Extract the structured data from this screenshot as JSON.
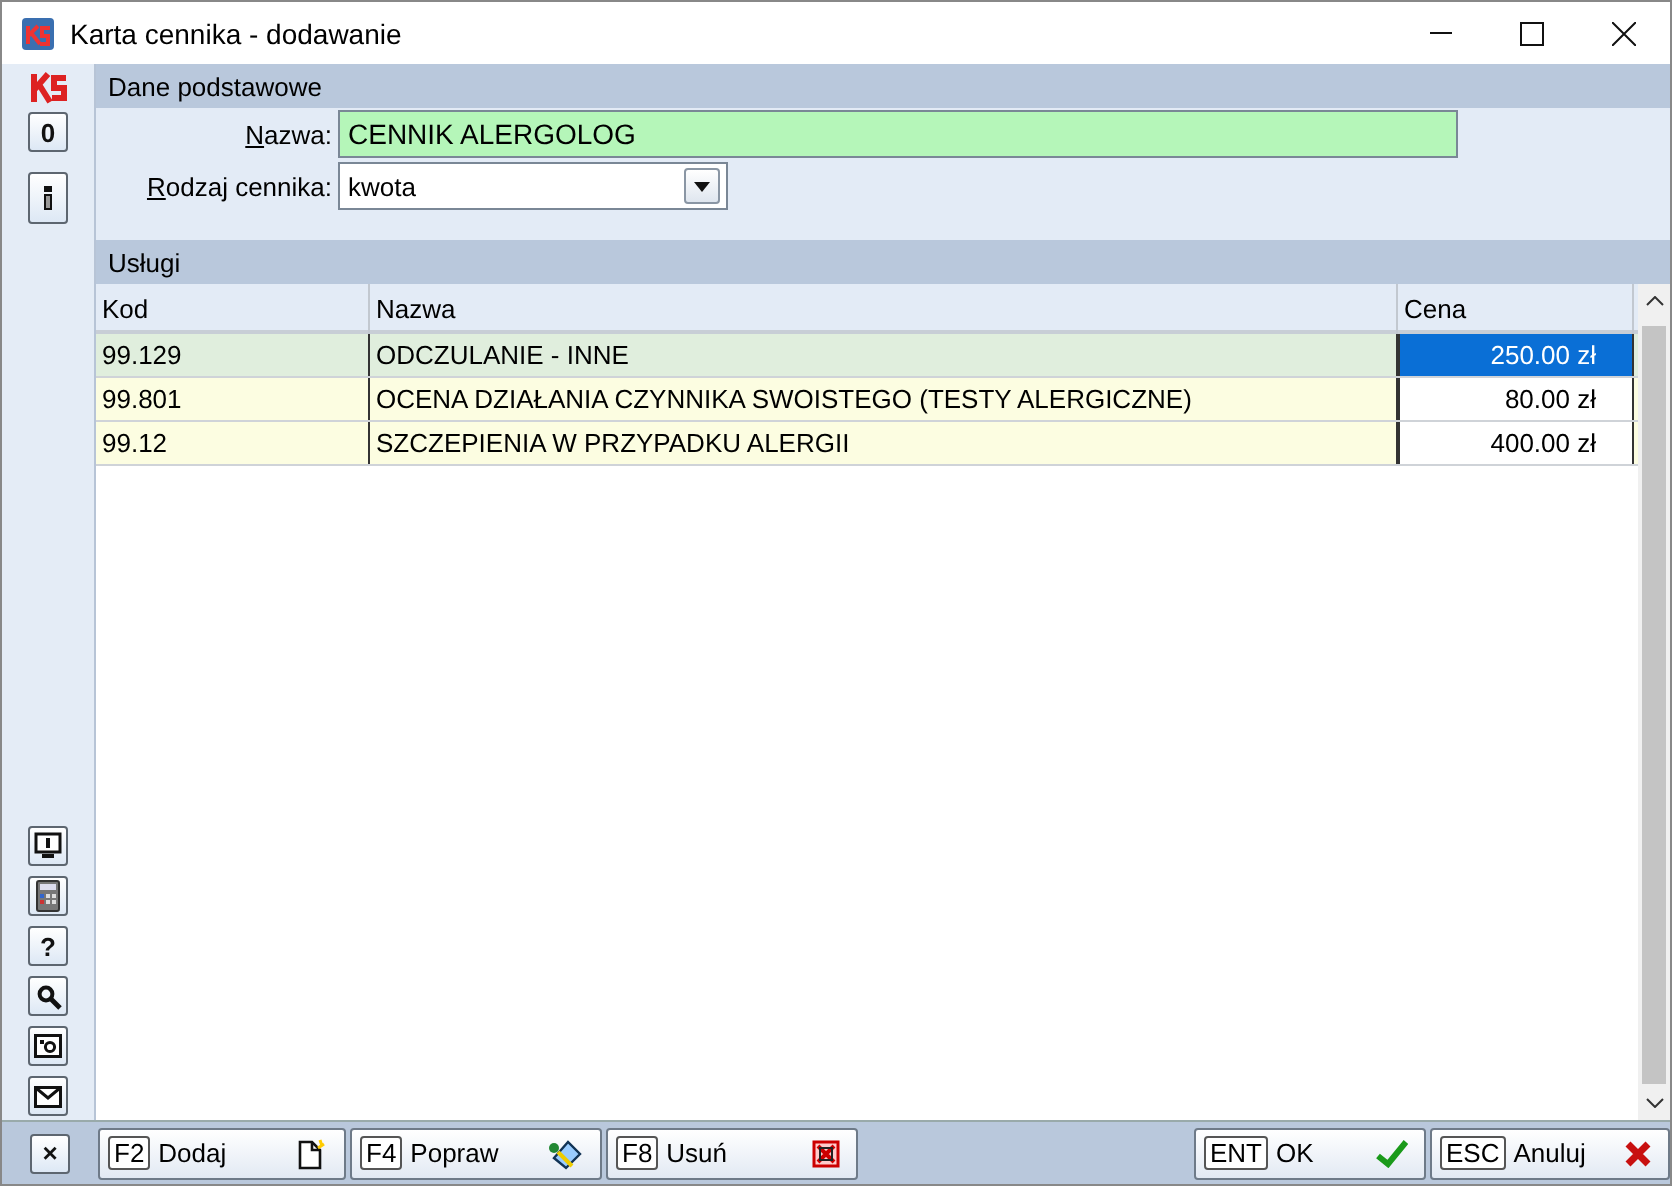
{
  "window": {
    "title": "Karta cennika - dodawanie"
  },
  "side_toolbar": {
    "top": [
      {
        "kind": "text",
        "label": "0"
      },
      {
        "kind": "info"
      }
    ],
    "bottom": [
      {
        "kind": "monitor"
      },
      {
        "kind": "calculator"
      },
      {
        "kind": "text",
        "label": "?"
      },
      {
        "kind": "search"
      },
      {
        "kind": "photo"
      },
      {
        "kind": "mail"
      },
      {
        "kind": "text",
        "label": "×"
      }
    ]
  },
  "basic": {
    "title": "Dane podstawowe",
    "name_label": "Nazwa:",
    "name_value": "CENNIK ALERGOLOG",
    "type_label": "Rodzaj cennika:",
    "type_value": "kwota"
  },
  "services": {
    "title": "Usługi",
    "columns": [
      "Kod",
      "Nazwa",
      "Cena"
    ],
    "rows": [
      {
        "code": "99.129",
        "name": "ODCZULANIE - INNE",
        "price": "250.00 zł",
        "selected": true
      },
      {
        "code": "99.801",
        "name": "OCENA DZIAŁANIA CZYNNIKA SWOISTEGO (TESTY ALERGICZNE)",
        "price": "80.00 zł",
        "selected": false
      },
      {
        "code": "99.12",
        "name": "SZCZEPIENIA W PRZYPADKU ALERGII",
        "price": "400.00 zł",
        "selected": false
      }
    ]
  },
  "actions_left": [
    {
      "key": "F2",
      "label": "Dodaj",
      "kind": "new"
    },
    {
      "key": "F4",
      "label": "Popraw",
      "kind": "edit"
    },
    {
      "key": "F8",
      "label": "Usuń",
      "kind": "delete"
    }
  ],
  "actions_right": [
    {
      "key": "ENT",
      "label": "OK",
      "kind": "ok"
    },
    {
      "key": "ESC",
      "label": "Anuluj",
      "kind": "cancel"
    }
  ]
}
